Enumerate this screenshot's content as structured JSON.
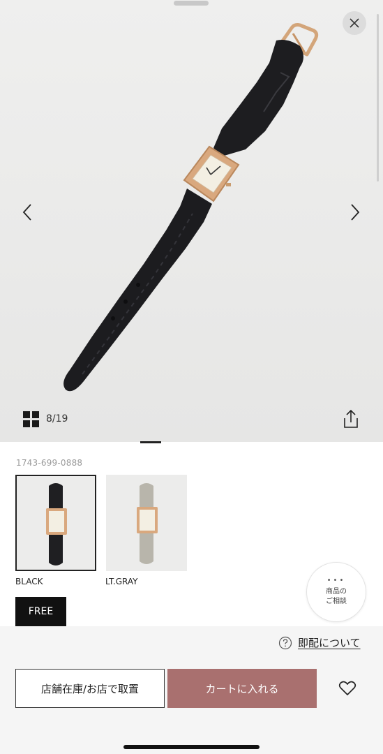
{
  "gallery": {
    "counter": "8/19",
    "icons": {
      "close": "close-icon",
      "prev": "chevron-left-icon",
      "next": "chevron-right-icon",
      "grid": "grid-icon",
      "share": "share-icon"
    }
  },
  "product": {
    "sku": "1743-699-0888",
    "colors": [
      {
        "label": "BLACK",
        "selected": true,
        "strap_color": "#1f1f22"
      },
      {
        "label": "LT.GRAY",
        "selected": false,
        "strap_color": "#b8b5ab"
      }
    ],
    "size": "FREE",
    "consult": {
      "line1": "商品の",
      "line2": "ご相談"
    }
  },
  "actions": {
    "delivery_link": "即配について",
    "store_button": "店舗在庫/お店で取置",
    "cart_button": "カートに入れる"
  },
  "colors": {
    "cart_accent": "#a9706f",
    "gallery_background": "#ebebea",
    "watch_case": "#d9a87e"
  }
}
